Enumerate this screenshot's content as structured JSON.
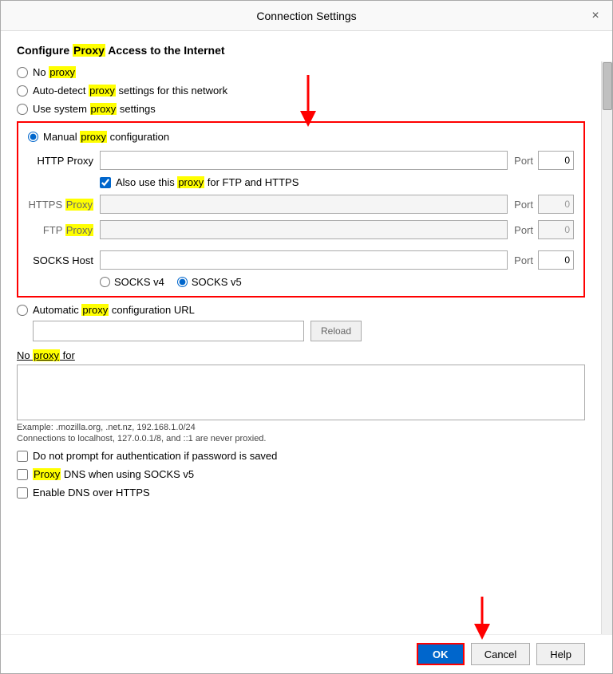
{
  "dialog": {
    "title": "Connection Settings",
    "close_label": "×"
  },
  "section": {
    "heading_pre": "Configure ",
    "heading_highlight": "Proxy",
    "heading_post": " Access to the Internet"
  },
  "radio_options": [
    {
      "id": "no-proxy",
      "label_pre": "No ",
      "label_highlight": "proxy",
      "label_post": "",
      "checked": false
    },
    {
      "id": "auto-detect",
      "label_pre": "Auto-detect ",
      "label_highlight": "proxy",
      "label_post": " settings for this network",
      "checked": false
    },
    {
      "id": "system-proxy",
      "label_pre": "Use system ",
      "label_highlight": "proxy",
      "label_post": " settings",
      "checked": false
    },
    {
      "id": "manual-proxy",
      "label_pre": "Manual ",
      "label_highlight": "proxy",
      "label_post": " configuration",
      "checked": true
    }
  ],
  "manual_proxy": {
    "http_label": "HTTP Proxy",
    "http_value": "",
    "http_port_label": "Port",
    "http_port_value": "0",
    "also_use_checkbox": true,
    "also_use_label_pre": "Also use this ",
    "also_use_highlight": "proxy",
    "also_use_label_post": " for FTP and HTTPS",
    "https_label": "HTTPS Proxy",
    "https_value": "",
    "https_port_label": "Port",
    "https_port_value": "0",
    "ftp_label": "FTP Proxy",
    "ftp_value": "",
    "ftp_port_label": "Port",
    "ftp_port_value": "0",
    "socks_label": "SOCKS Host",
    "socks_value": "",
    "socks_port_label": "Port",
    "socks_port_value": "0",
    "socks_v4_label": "SOCKS v4",
    "socks_v5_label": "SOCKS v5"
  },
  "auto_proxy": {
    "label_pre": "Automatic ",
    "label_highlight": "proxy",
    "label_post": " configuration URL",
    "url_value": "",
    "url_placeholder": "",
    "reload_label": "Reload"
  },
  "no_proxy": {
    "title_pre": "No ",
    "title_highlight": "proxy",
    "title_post": " for",
    "textarea_value": "",
    "hint1": "Example: .mozilla.org, .net.nz, 192.168.1.0/24",
    "hint2": "Connections to localhost, 127.0.0.1/8, and ::1 are never proxied."
  },
  "checkboxes": [
    {
      "id": "no-auth-prompt",
      "label": "Do not prompt for authentication if password is saved",
      "checked": false
    },
    {
      "id": "proxy-dns",
      "label_pre": "",
      "label_highlight": "Proxy",
      "label_post": " DNS when using SOCKS v5",
      "checked": false
    },
    {
      "id": "dns-over-https",
      "label": "Enable DNS over HTTPS",
      "checked": false
    }
  ],
  "footer": {
    "ok_label": "OK",
    "cancel_label": "Cancel",
    "help_label": "Help"
  }
}
